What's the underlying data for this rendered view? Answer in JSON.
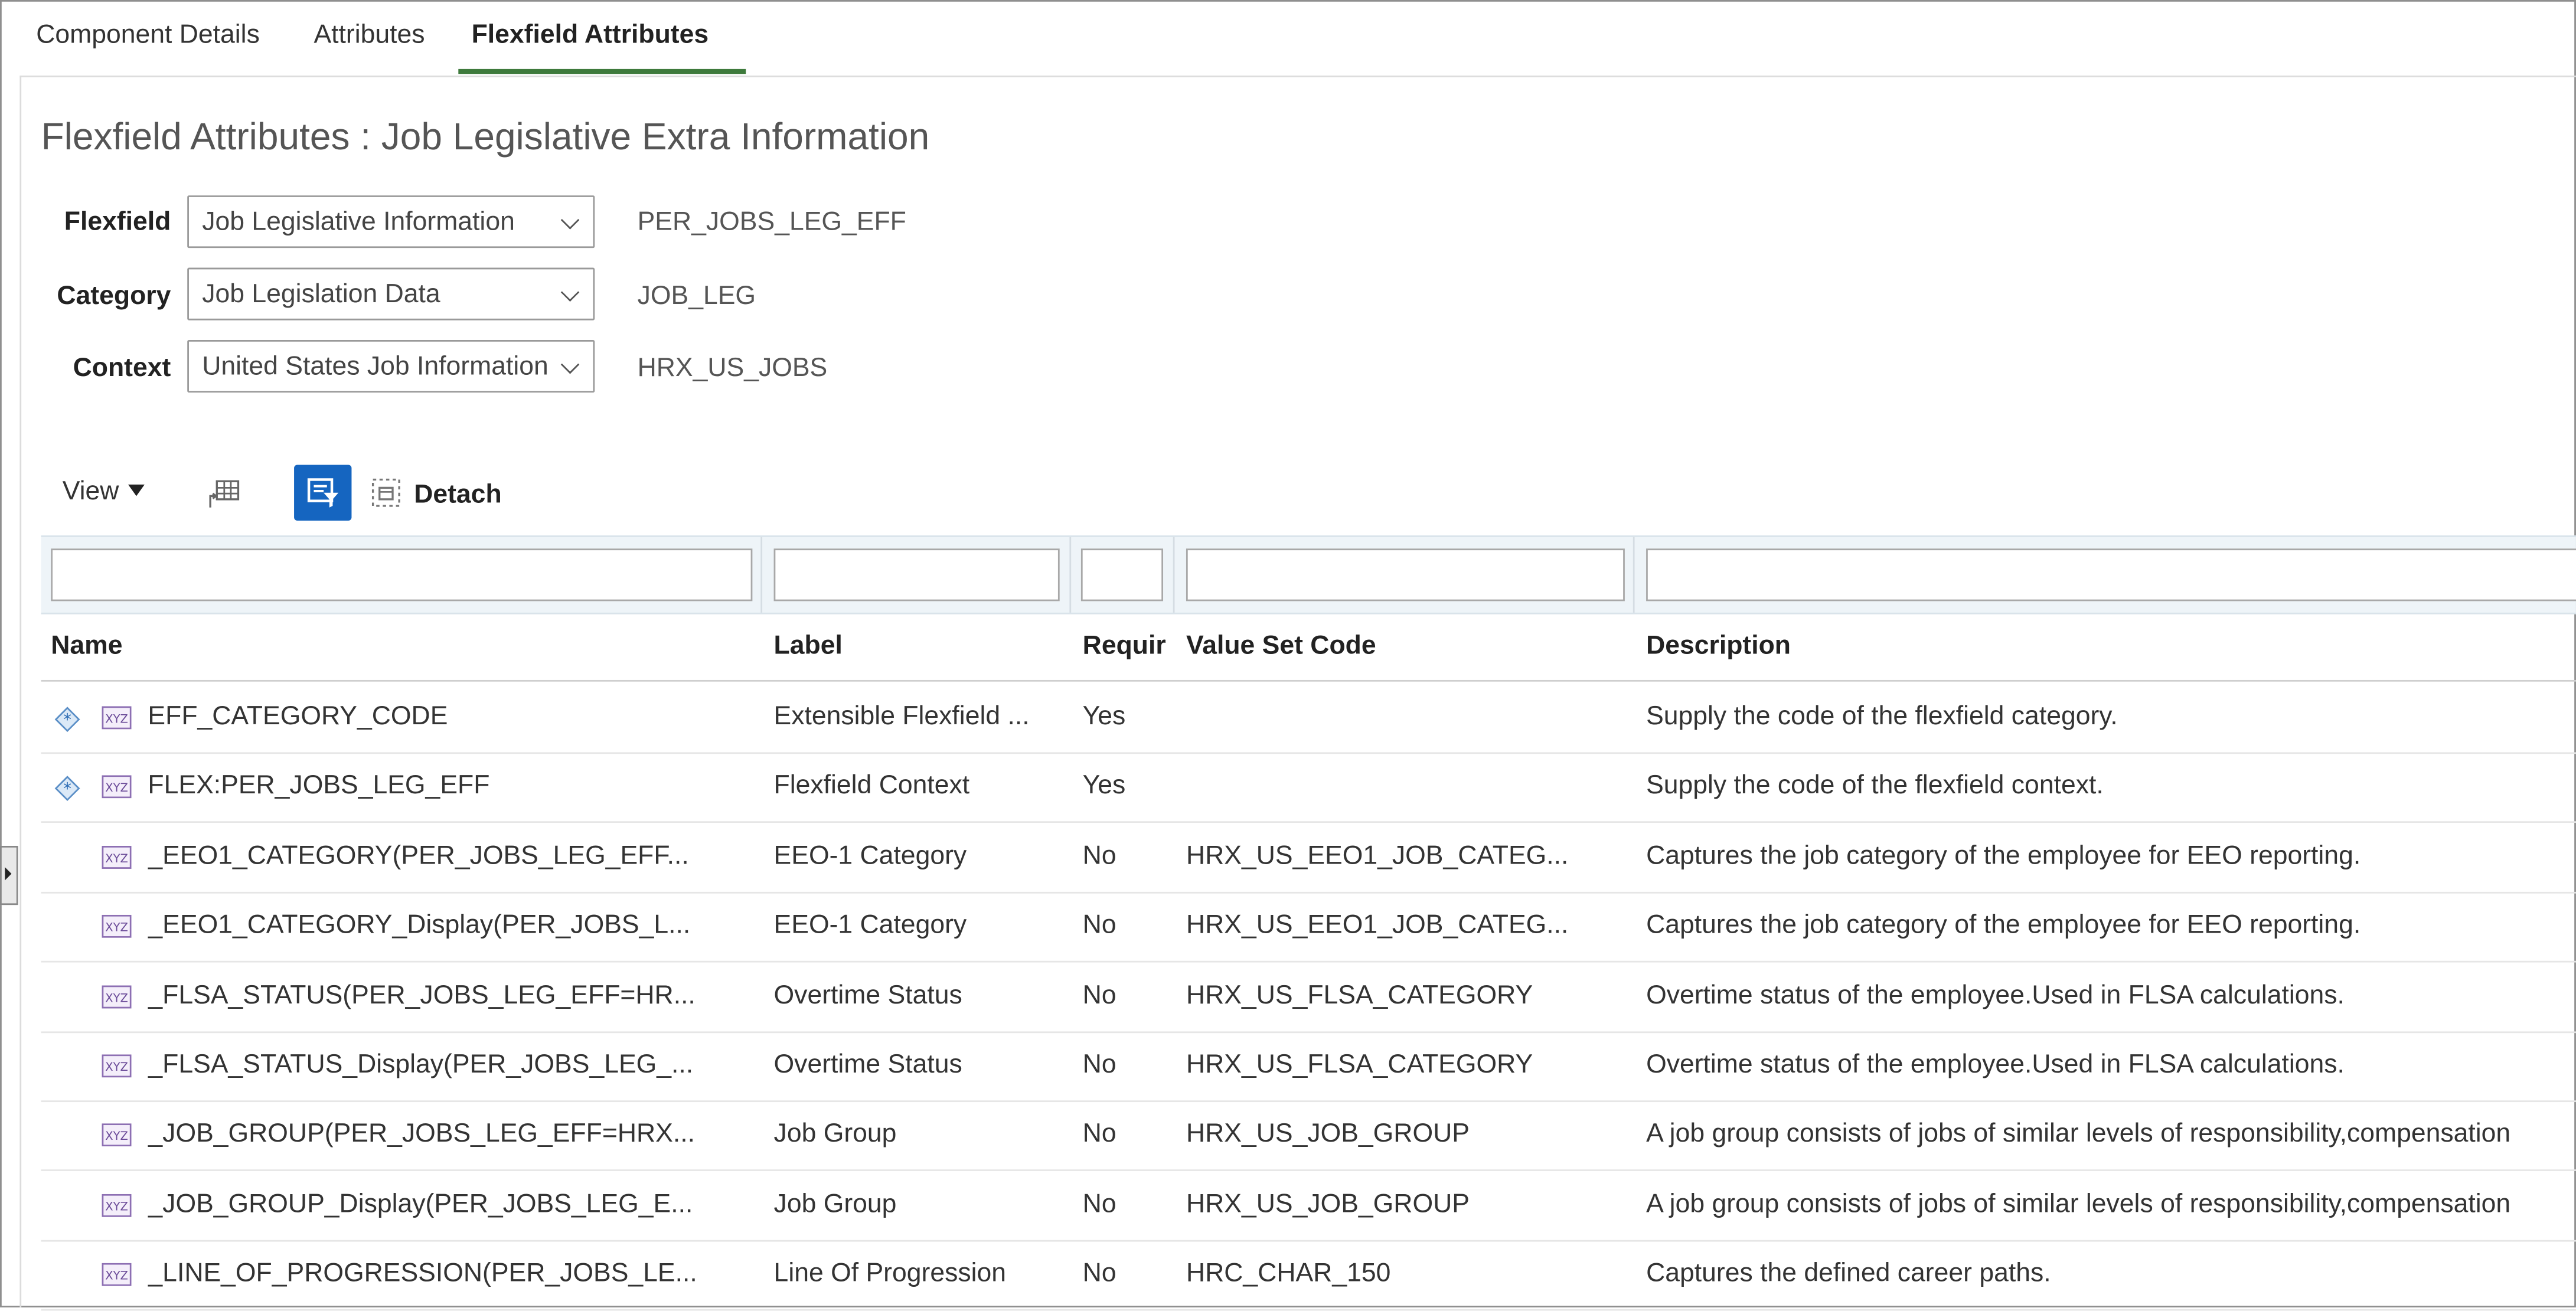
{
  "tabs": [
    {
      "label": "Component Details"
    },
    {
      "label": "Attributes"
    },
    {
      "label": "Flexfield Attributes"
    }
  ],
  "page_title": "Flexfield Attributes : Job Legislative Extra Information",
  "form": {
    "flexfield": {
      "label": "Flexfield",
      "value": "Job Legislative Information",
      "code": "PER_JOBS_LEG_EFF"
    },
    "category": {
      "label": "Category",
      "value": "Job Legislation Data",
      "code": "JOB_LEG"
    },
    "context": {
      "label": "Context",
      "value": "United States Job Information",
      "code": "HRX_US_JOBS"
    }
  },
  "toolbar": {
    "view_label": "View",
    "detach_label": "Detach",
    "icons": [
      "freeze-columns-icon",
      "query-by-example-icon",
      "detach-icon"
    ]
  },
  "table": {
    "columns": [
      {
        "label": "Name"
      },
      {
        "label": "Label"
      },
      {
        "label": "Requir"
      },
      {
        "label": "Value Set Code"
      },
      {
        "label": "Description"
      }
    ],
    "rows": [
      {
        "required_icon": true,
        "name": "EFF_CATEGORY_CODE",
        "label": "Extensible Flexfield ...",
        "required": "Yes",
        "value_set": "",
        "description": "Supply the code of the flexfield category."
      },
      {
        "required_icon": true,
        "name": "FLEX:PER_JOBS_LEG_EFF",
        "label": "Flexfield Context",
        "required": "Yes",
        "value_set": "",
        "description": "Supply the code of the flexfield context."
      },
      {
        "required_icon": false,
        "name": "_EEO1_CATEGORY(PER_JOBS_LEG_EFF...",
        "label": "EEO-1 Category",
        "required": "No",
        "value_set": "HRX_US_EEO1_JOB_CATEG...",
        "description": "Captures the job category of the employee for EEO reporting."
      },
      {
        "required_icon": false,
        "name": "_EEO1_CATEGORY_Display(PER_JOBS_L...",
        "label": "EEO-1 Category",
        "required": "No",
        "value_set": "HRX_US_EEO1_JOB_CATEG...",
        "description": "Captures the job category of the employee for EEO reporting."
      },
      {
        "required_icon": false,
        "name": "_FLSA_STATUS(PER_JOBS_LEG_EFF=HR...",
        "label": "Overtime Status",
        "required": "No",
        "value_set": "HRX_US_FLSA_CATEGORY",
        "description": "Overtime status of the employee.Used in FLSA calculations."
      },
      {
        "required_icon": false,
        "name": "_FLSA_STATUS_Display(PER_JOBS_LEG_...",
        "label": "Overtime Status",
        "required": "No",
        "value_set": "HRX_US_FLSA_CATEGORY",
        "description": "Overtime status of the employee.Used in FLSA calculations."
      },
      {
        "required_icon": false,
        "name": "_JOB_GROUP(PER_JOBS_LEG_EFF=HRX...",
        "label": "Job Group",
        "required": "No",
        "value_set": "HRX_US_JOB_GROUP",
        "description": "A job group consists of jobs of similar levels of responsibility,compensation"
      },
      {
        "required_icon": false,
        "name": "_JOB_GROUP_Display(PER_JOBS_LEG_E...",
        "label": "Job Group",
        "required": "No",
        "value_set": "HRX_US_JOB_GROUP",
        "description": "A job group consists of jobs of similar levels of responsibility,compensation"
      },
      {
        "required_icon": false,
        "name": "_LINE_OF_PROGRESSION(PER_JOBS_LE...",
        "label": "Line Of Progression",
        "required": "No",
        "value_set": "HRC_CHAR_150",
        "description": "Captures the defined career paths."
      }
    ]
  },
  "colors": {
    "accent": "#1565c0",
    "tab_underline": "#3e7a3c",
    "filter_row_bg": "#eef4f8"
  }
}
